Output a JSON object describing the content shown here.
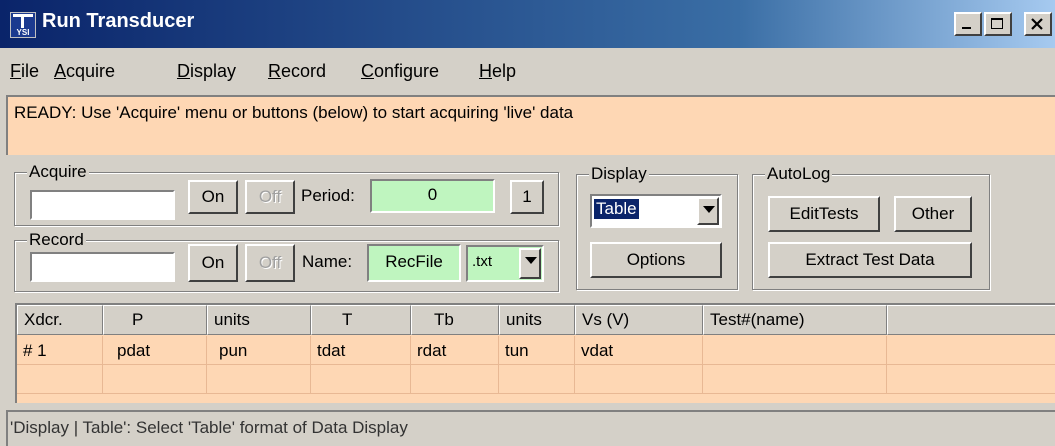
{
  "window": {
    "title": "Run Transducer",
    "icon_label": "YSI"
  },
  "menu": [
    {
      "label": "File",
      "accel": "F",
      "rest": "ile"
    },
    {
      "label": "Acquire",
      "accel": "A",
      "rest": "cquire"
    },
    {
      "label": "Display",
      "accel": "D",
      "rest": "isplay"
    },
    {
      "label": "Record",
      "accel": "R",
      "rest": "ecord"
    },
    {
      "label": "Configure",
      "accel": "C",
      "rest": "onfigure"
    },
    {
      "label": "Help",
      "accel": "H",
      "rest": "elp"
    }
  ],
  "message": "READY: Use 'Acquire' menu or buttons (below) to start acquiring 'live' data",
  "acquire": {
    "group_title": "Acquire",
    "on_label": "On",
    "off_label": "Off",
    "period_label": "Period:",
    "period_value": "0",
    "step_label": "1"
  },
  "record": {
    "group_title": "Record",
    "on_label": "On",
    "off_label": "Off",
    "name_label": "Name:",
    "name_value": "RecFile",
    "ext_value": ".txt"
  },
  "display": {
    "group_title": "Display",
    "format_value": "Table",
    "options_label": "Options"
  },
  "autolog": {
    "group_title": "AutoLog",
    "edit_tests_label": "EditTests",
    "other_label": "Other",
    "extract_label": "Extract Test Data"
  },
  "table": {
    "columns": [
      "Xdcr.",
      "P",
      "units",
      "T",
      "Tb",
      "units",
      "Vs (V)",
      "Test#(name)",
      ""
    ],
    "rows": [
      [
        "# 1",
        "pdat",
        "pun",
        "tdat",
        "rdat",
        "tun",
        "vdat",
        "",
        ""
      ],
      [
        "",
        "",
        "",
        "",
        "",
        "",
        "",
        "",
        ""
      ]
    ]
  },
  "status_bar": "'Display | Table': Select 'Table' format of Data Display",
  "colors": {
    "face": "#d4d0c8",
    "peach": "#fed7b4",
    "green_field": "#bff5bf",
    "title_start": "#0a246a",
    "selection": "#0a246a"
  }
}
